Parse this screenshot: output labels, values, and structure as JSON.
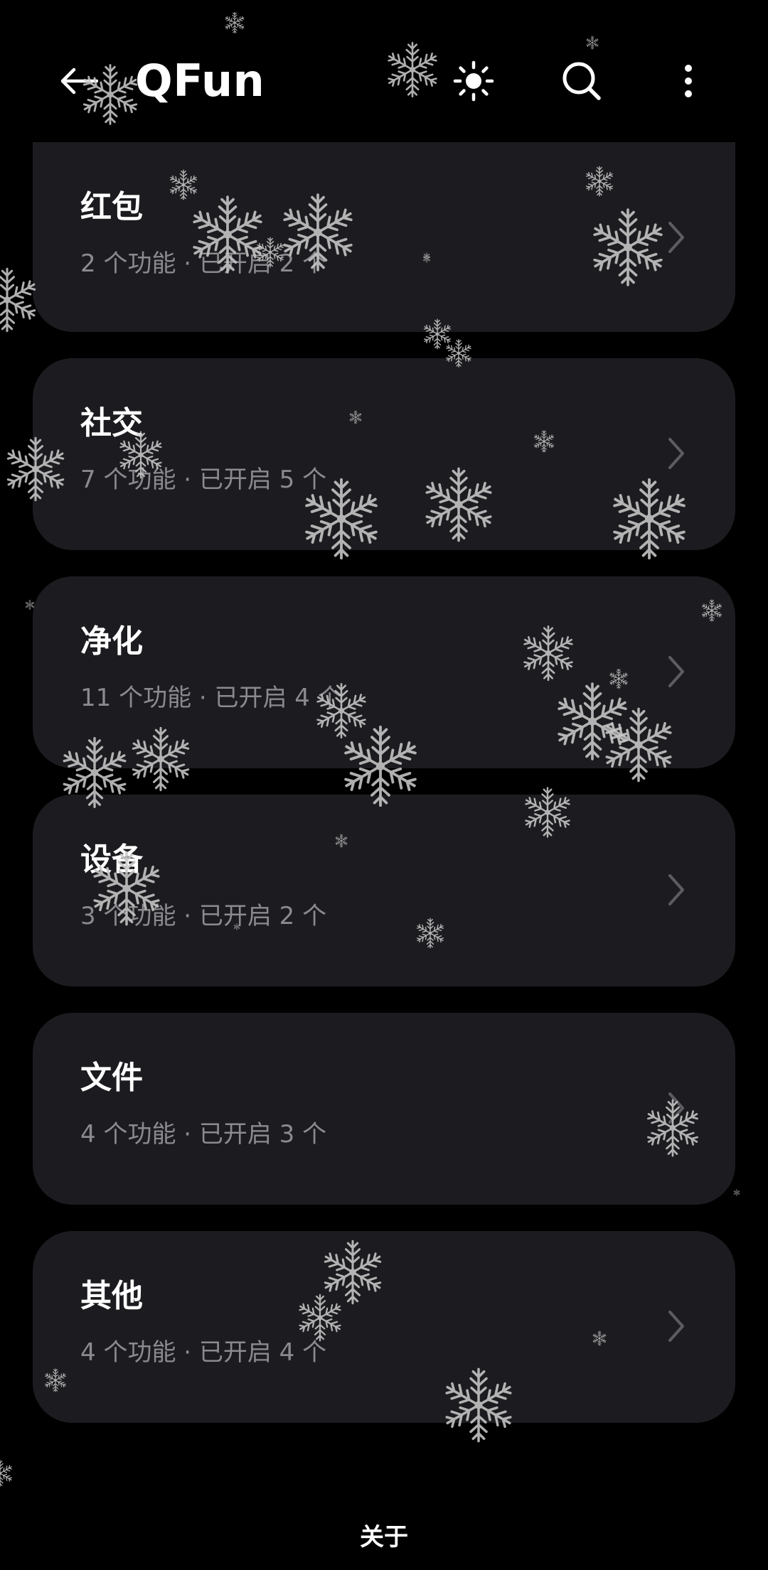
{
  "header": {
    "title": "QFun",
    "back_icon": "arrow-left-icon",
    "theme_icon": "sun-icon",
    "search_icon": "search-icon",
    "more_icon": "more-vertical-icon"
  },
  "categories": [
    {
      "title": "红包",
      "subtitle": "2 个功能 · 已开启 2 个"
    },
    {
      "title": "社交",
      "subtitle": "7 个功能 · 已开启 5 个"
    },
    {
      "title": "净化",
      "subtitle": "11 个功能 · 已开启 4 个"
    },
    {
      "title": "设备",
      "subtitle": "3 个功能 · 已开启 2 个"
    },
    {
      "title": "文件",
      "subtitle": "4 个功能 · 已开启 3 个"
    },
    {
      "title": "其他",
      "subtitle": "4 个功能 · 已开启 4 个"
    }
  ],
  "footer": {
    "about_label": "关于"
  },
  "colors": {
    "background": "#000000",
    "card": "#1c1c20",
    "subtitle": "#8a8a8f",
    "chevron": "#5c5c62",
    "snowflake": "#c8c8c8"
  }
}
